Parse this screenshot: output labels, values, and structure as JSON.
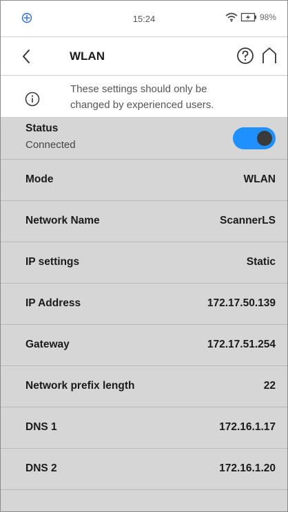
{
  "status_bar": {
    "time": "15:24",
    "battery_percent": "98%",
    "icons": [
      "app-logo-icon",
      "wifi-icon",
      "battery-charging-icon"
    ]
  },
  "header": {
    "title": "WLAN",
    "icons": [
      "chevron-left-icon",
      "help-icon",
      "home-icon"
    ]
  },
  "notice": {
    "line1": "These settings should only be",
    "line2": "changed by experienced users.",
    "icon": "info-icon"
  },
  "status": {
    "label": "Status",
    "value": "Connected",
    "toggle_on": true
  },
  "rows": [
    {
      "label": "Mode",
      "value": "WLAN"
    },
    {
      "label": "Network Name",
      "value": "ScannerLS"
    },
    {
      "label": "IP settings",
      "value": "Static"
    },
    {
      "label": "IP Address",
      "value": "172.17.50.139"
    },
    {
      "label": "Gateway",
      "value": "172.17.51.254"
    },
    {
      "label": "Network prefix length",
      "value": "22"
    },
    {
      "label": "DNS 1",
      "value": "172.16.1.17"
    },
    {
      "label": "DNS 2",
      "value": "172.16.1.20"
    }
  ],
  "colors": {
    "toggle_on": "#1e90ff",
    "row_background": "#d6d6d6",
    "header_background": "#ffffff"
  }
}
